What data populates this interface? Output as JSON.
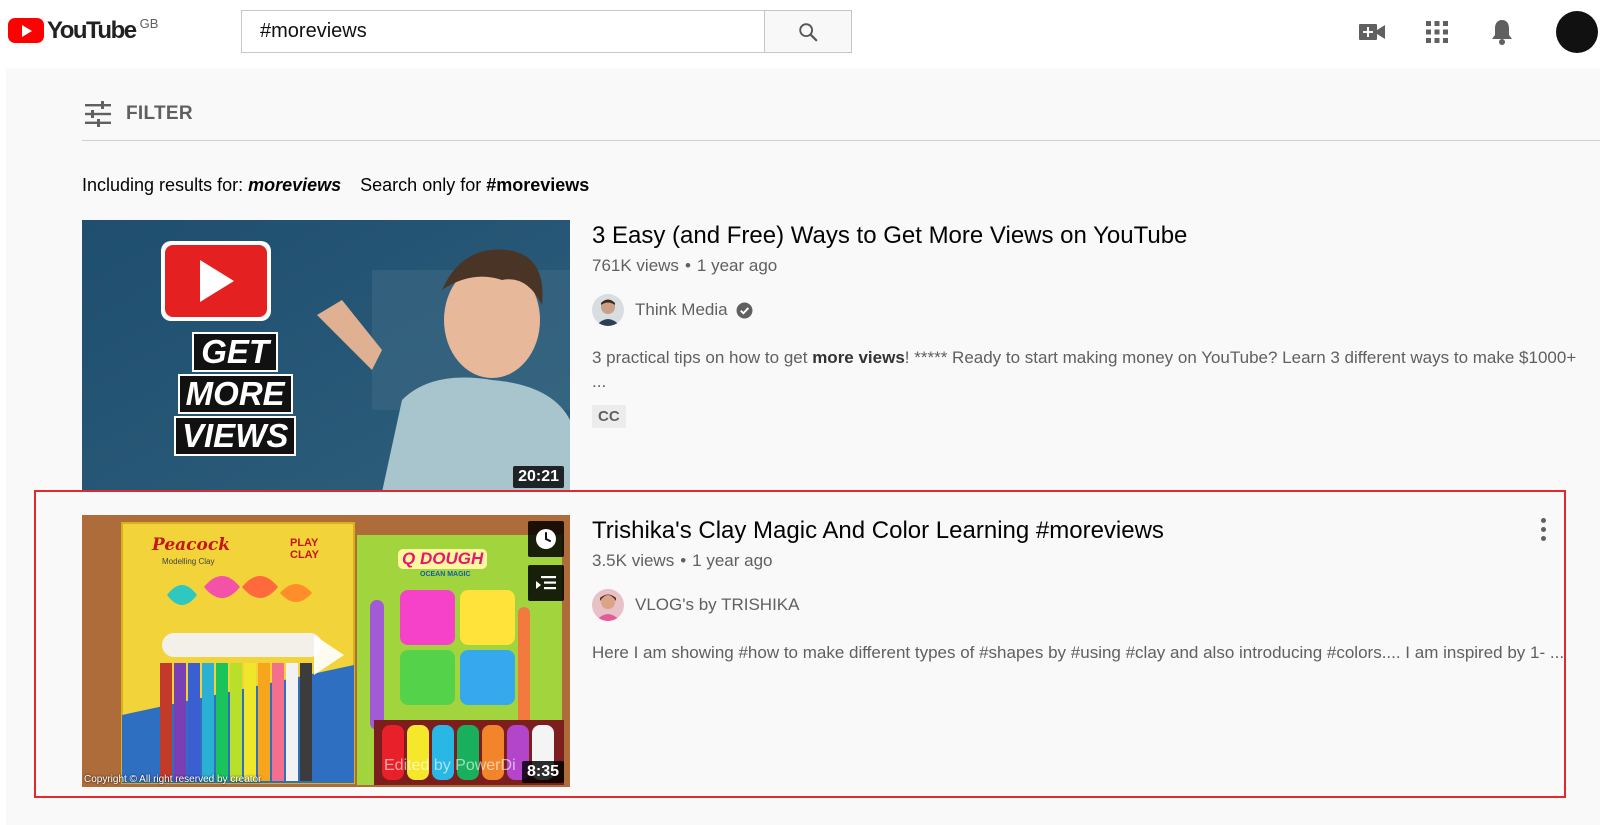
{
  "masthead": {
    "logo_text": "YouTube",
    "region": "GB",
    "search_value": "#moreviews",
    "icons": [
      "create-video-icon",
      "apps-grid-icon",
      "notifications-bell-icon",
      "account-avatar"
    ]
  },
  "filter": {
    "label": "FILTER"
  },
  "spelling": {
    "including_prefix": "Including results for: ",
    "including_term": "moreviews",
    "search_only_prefix": "Search only for ",
    "search_only_term": "#moreviews"
  },
  "videos": [
    {
      "title": "3 Easy (and Free) Ways to Get More Views on YouTube",
      "views": "761K views",
      "age": "1 year ago",
      "channel": "Think Media",
      "verified": true,
      "description_pre": "3 practical tips on how to get ",
      "description_bold": "more views",
      "description_post": "! ***** Ready to start making money on YouTube? Learn 3 different ways to make $1000+ ...",
      "badge": "CC",
      "duration": "20:21",
      "thumb_text": [
        "GET",
        "MORE",
        "VIEWS"
      ]
    },
    {
      "title": "Trishika's Clay Magic And Color Learning #moreviews",
      "views": "3.5K views",
      "age": "1 year ago",
      "channel": "VLOG's by TRISHIKA",
      "verified": false,
      "description": "Here I am showing #how to make different types of #shapes by #using #clay and also introducing #colors.... I am inspired by 1- ...",
      "duration": "8:35",
      "thumb_caption": "Copyright © All right reserved by creator",
      "thumb_watermark": "Edited by PowerDi",
      "thumb_brand_left": "Peacock",
      "thumb_brand_left_sub": "Modelling Clay",
      "thumb_play_clay": "PLAY CLAY",
      "thumb_brand_right": "Q DOUGH",
      "thumb_brand_right_sub": "OCEAN MAGIC"
    }
  ],
  "colors": {
    "brand_red": "#ff0000",
    "highlight_border": "#e0292e",
    "page_bg": "#f9f9f9"
  }
}
